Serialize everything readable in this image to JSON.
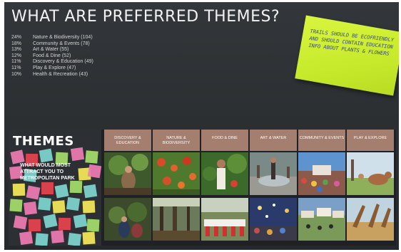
{
  "board": {
    "title": "WHAT ARE PREFERRED THEMES?",
    "stats": [
      {
        "pct": "24%",
        "label": "Nature & Biodiversity (104)"
      },
      {
        "pct": "18%",
        "label": "Community & Events (78)"
      },
      {
        "pct": "13%",
        "label": "Art & Water (55)"
      },
      {
        "pct": "12%",
        "label": "Food & Dine (52)"
      },
      {
        "pct": "11%",
        "label": "Discovery & Education (49)"
      },
      {
        "pct": "11%",
        "label": "Play & Explore (47)"
      },
      {
        "pct": "10%",
        "label": "Health & Recreation (43)"
      }
    ]
  },
  "sticky_note": {
    "text": "TRAILS SHOULD BE ECOFRIENDLY AND SHOULD CONTAIN EDUCATION INFO ABOUT PLANTS & FLOWERS",
    "color": "#cdec34"
  },
  "themes_panel": {
    "heading": "THEMES",
    "question": "WHAT WOULD MOST ATTRACT YOU TO METROPOLITAN PARK",
    "columns": [
      {
        "label": "DISCOVERY & EDUCATION"
      },
      {
        "label": "NATURE & BIODIVERSITY"
      },
      {
        "label": "FOOD & DINE"
      },
      {
        "label": "ART & WATER"
      },
      {
        "label": "COMMUNITY & EVENTS"
      },
      {
        "label": "PLAY & EXPLORE"
      }
    ],
    "header_color": "#a47e6f"
  },
  "colors": {
    "board_bg": "#2e3134",
    "panel_bg": "#1f2124",
    "sticky_pink": "#f07cb4",
    "sticky_teal": "#7fd6cf",
    "sticky_green": "#a6e06b",
    "sticky_red": "#e8434f",
    "sticky_yellow": "#f5ea5a"
  }
}
